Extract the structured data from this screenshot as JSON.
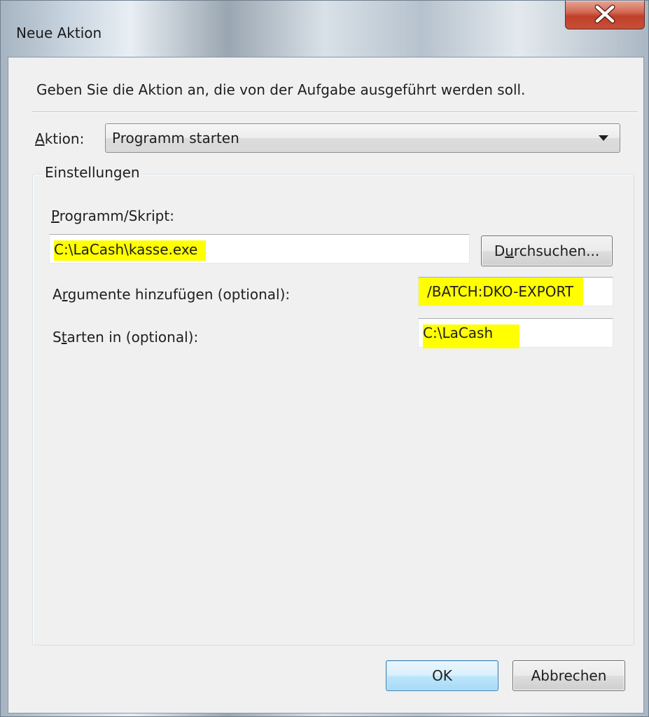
{
  "window": {
    "title": "Neue Aktion"
  },
  "dialog": {
    "prompt": "Geben Sie die Aktion an, die von der Aufgabe ausgeführt werden soll.",
    "action_label_underlined": "A",
    "action_label_rest": "ktion:",
    "action_value": "Programm starten",
    "settings_group_label": "Einstellungen",
    "program_label_underlined": "P",
    "program_label_rest": "rogramm/Skript:",
    "program_value": "C:\\LaCash\\kasse.exe",
    "browse_label_pre": "D",
    "browse_label_underlined": "u",
    "browse_label_post": "rchsuchen...",
    "arguments_label_pre": "A",
    "arguments_label_underlined": "r",
    "arguments_label_post": "gumente hinzufügen (optional):",
    "arguments_value": "/BATCH:DKO-EXPORT",
    "start_in_label_pre": "S",
    "start_in_label_underlined": "t",
    "start_in_label_post": "arten in (optional):",
    "start_in_value": "C:\\LaCash",
    "ok_label": "OK",
    "cancel_label": "Abbrechen"
  },
  "colors": {
    "highlight": "#ffff00",
    "client_background": "#f0f0f0",
    "close_button": "#c8432c"
  }
}
